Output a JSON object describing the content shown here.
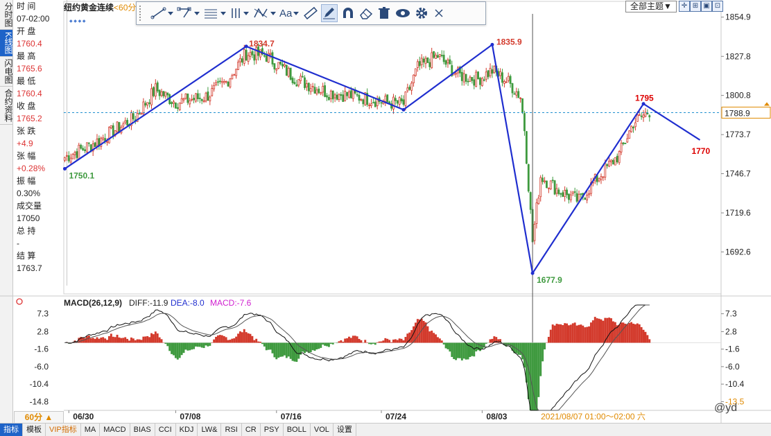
{
  "left_tabs": [
    "分时图",
    "K线图",
    "闪电图",
    "合约资料"
  ],
  "active_tab": "K线图",
  "info": {
    "time_label": "时 间",
    "time_value": "07-02:00",
    "open_label": "开 盘",
    "open_value": "1760.4",
    "high_label": "最 高",
    "high_value": "1765.6",
    "low_label": "最 低",
    "low_value": "1760.4",
    "close_label": "收 盘",
    "close_value": "1765.2",
    "change_label": "张 跌",
    "change_value": "+4.9",
    "pct_label": "张 幅",
    "pct_value": "+0.28%",
    "amp_label": "振 幅",
    "amp_value": "0.30%",
    "vol_label": "成交量",
    "vol_value": "17050",
    "hold_label": "总 持",
    "hold_value": "-",
    "settle_label": "结 算",
    "settle_value": "1763.7"
  },
  "title": "纽约黄金连续",
  "period_suffix": "<60分",
  "theme_button": "全部主题▼",
  "toolbar_icons": [
    "line-tool-icon",
    "polyline-tool-icon",
    "fib-tool-icon",
    "parallel-tool-icon",
    "pattern-tool-icon",
    "text-tool-icon",
    "ruler-icon",
    "pen-icon",
    "magnet-icon",
    "eraser-icon",
    "trash-icon",
    "eye-icon",
    "gear-icon",
    "close-icon"
  ],
  "toolbar_text_label": "Aa",
  "macd_label": "MACD(26,12,9)",
  "macd_diff": "DIFF:-11.9",
  "macd_dea": "DEA:-8.0",
  "macd_macd": "MACD:-7.6",
  "crosshair_time": "2021/08/07 01:00～02:00 六",
  "period_button": "60分 ▲",
  "bottom_tabs": [
    "指标",
    "模板",
    "VIP指标",
    "MA",
    "MACD",
    "BIAS",
    "CCI",
    "KDJ",
    "LW&",
    "RSI",
    "CR",
    "PSY",
    "BOLL",
    "VOL",
    "设置"
  ],
  "watermark": "@yd",
  "colors": {
    "up": "#d33a2c",
    "down": "#3f9a3f",
    "trend": "#1f2ecf",
    "grid": "#e6e6e6",
    "price_line": "#1e8fcf"
  },
  "chart_data": [
    {
      "type": "candlestick",
      "title": "纽约黄金连续",
      "y_ticks": [
        1854.9,
        1827.8,
        1800.8,
        1773.7,
        1746.7,
        1719.6,
        1692.6
      ],
      "ylim": [
        1665.5,
        1861.0
      ],
      "x_ticks": [
        "06/30",
        "07/08",
        "07/16",
        "07/24",
        "08/03"
      ],
      "current_price": "1788.9",
      "pivots": [
        {
          "label": "1750.1",
          "value": 1750.1,
          "idx": 0
        },
        {
          "label": "1834.7",
          "value": 1834.7,
          "idx": 90
        },
        {
          "label": "",
          "value": 1790.9,
          "idx": 168
        },
        {
          "label": "1835.9",
          "value": 1835.9,
          "idx": 212
        },
        {
          "label": "1677.9",
          "value": 1677.9,
          "idx": 232
        },
        {
          "label": "1795",
          "value": 1795.0,
          "idx": 287
        },
        {
          "label": "1770",
          "value": 1770.0,
          "idx": 315
        }
      ],
      "anchors": [
        [
          0,
          1758
        ],
        [
          15,
          1768
        ],
        [
          35,
          1786
        ],
        [
          45,
          1805
        ],
        [
          55,
          1796
        ],
        [
          70,
          1800
        ],
        [
          80,
          1810
        ],
        [
          90,
          1830
        ],
        [
          100,
          1828
        ],
        [
          115,
          1812
        ],
        [
          130,
          1803
        ],
        [
          145,
          1800
        ],
        [
          160,
          1796
        ],
        [
          168,
          1795
        ],
        [
          175,
          1820
        ],
        [
          185,
          1828
        ],
        [
          195,
          1815
        ],
        [
          205,
          1812
        ],
        [
          212,
          1818
        ],
        [
          220,
          1810
        ],
        [
          226,
          1800
        ],
        [
          228,
          1778
        ],
        [
          232,
          1700
        ],
        [
          236,
          1745
        ],
        [
          245,
          1735
        ],
        [
          255,
          1728
        ],
        [
          265,
          1745
        ],
        [
          275,
          1760
        ],
        [
          282,
          1782
        ],
        [
          290,
          1790
        ]
      ],
      "last_index": 290,
      "total_slots": 326
    },
    {
      "type": "macd",
      "title": "MACD(26,12,9)",
      "y_ticks": [
        7.3,
        2.8,
        -1.6,
        -6.0,
        -10.4,
        -14.8
      ],
      "right_ticks": [
        "7.3",
        "2.8",
        "-1.6",
        "-6.0",
        "-10.4",
        "-13.5"
      ],
      "ylim": [
        -17.0,
        9.5
      ],
      "series": [
        {
          "name": "DIFF",
          "last": -11.9
        },
        {
          "name": "DEA",
          "last": -8.0
        },
        {
          "name": "MACD",
          "last": -7.6
        }
      ]
    }
  ]
}
